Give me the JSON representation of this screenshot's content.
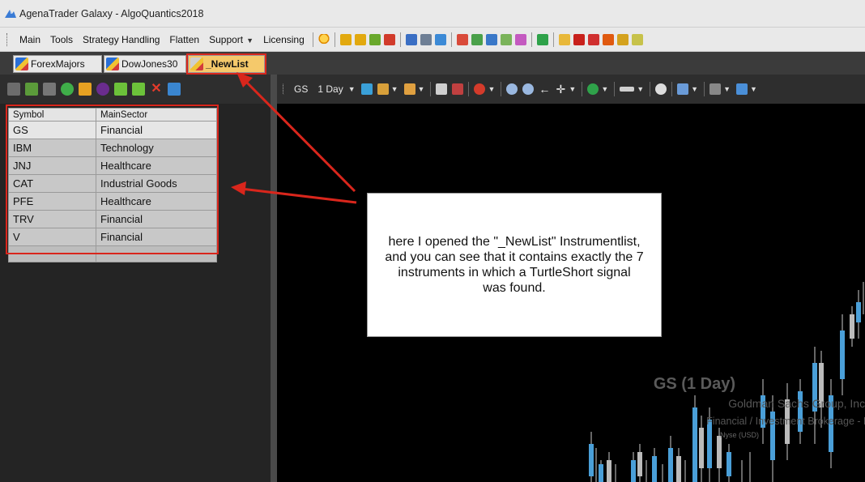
{
  "window": {
    "title": "AgenaTrader Galaxy - AlgoQuantics2018",
    "app_icon": "agenatrader-logo-icon"
  },
  "menu": {
    "items": [
      {
        "label": "Main",
        "dropdown": false
      },
      {
        "label": "Tools",
        "dropdown": false
      },
      {
        "label": "Strategy Handling",
        "dropdown": false
      },
      {
        "label": "Flatten",
        "dropdown": false
      },
      {
        "label": "Support",
        "dropdown": true
      },
      {
        "label": "Licensing",
        "dropdown": false
      }
    ]
  },
  "tabs": [
    {
      "label": "ForexMajors",
      "active": false
    },
    {
      "label": "DowJones30",
      "active": false
    },
    {
      "label": "_NewList",
      "active": true
    }
  ],
  "chart_toolbar": {
    "symbol": "GS",
    "timeframe": "1 Day"
  },
  "instrument_list": {
    "columns": [
      "Symbol",
      "MainSector"
    ],
    "rows": [
      [
        "GS",
        "Financial"
      ],
      [
        "IBM",
        "Technology"
      ],
      [
        "JNJ",
        "Healthcare"
      ],
      [
        "CAT",
        "Industrial Goods"
      ],
      [
        "PFE",
        "Healthcare"
      ],
      [
        "TRV",
        "Financial"
      ],
      [
        "V",
        "Financial"
      ]
    ]
  },
  "chart": {
    "watermark_title": "GS (1 Day)",
    "watermark_name": "Goldman Sachs Group, Inc.",
    "watermark_sector": "Financial / Investment Brokerage - Na",
    "watermark_exchange": "Nyse  (USD)"
  },
  "annotation": {
    "text": "here I opened the \"_NewList\" Instrumentlist, and you can see that it contains exactly the 7 instruments in which a TurtleShort signal was found.",
    "highlight_color": "#d9261c"
  }
}
